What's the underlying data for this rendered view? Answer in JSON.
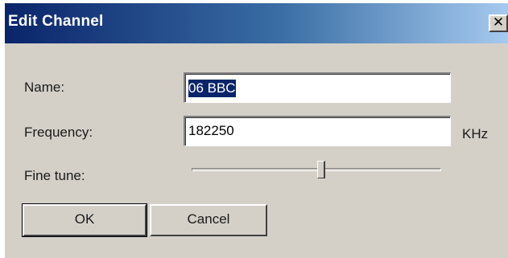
{
  "window": {
    "title": "Edit Channel",
    "close_glyph": "✕",
    "close_icon": "close-icon"
  },
  "form": {
    "name_label": "Name:",
    "name_value": "06 BBC",
    "frequency_label": "Frequency:",
    "frequency_value": "182250",
    "frequency_unit": "KHz",
    "fine_tune_label": "Fine tune:",
    "fine_tune_level": 0.52
  },
  "buttons": {
    "ok_label": "OK",
    "cancel_label": "Cancel"
  },
  "colors": {
    "titlebar_start": "#0a246a",
    "titlebar_end": "#a6caf0",
    "dialog_face": "#d4d0c8",
    "selection": "#0a246a"
  }
}
